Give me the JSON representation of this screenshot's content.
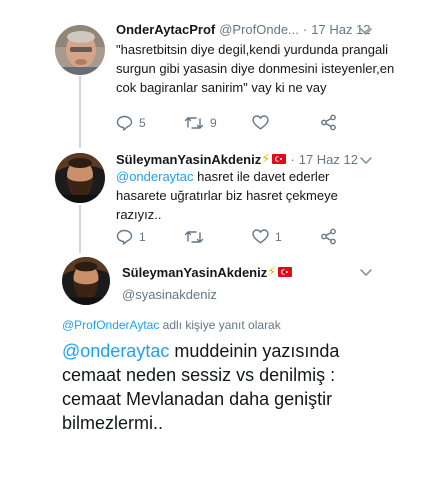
{
  "tweets": [
    {
      "name": "OnderAytacProf",
      "handle": "@ProfOnde...",
      "dot": "·",
      "time": "17 Haz 12",
      "text": "\"hasretbitsin diye degil,kendi yurdunda prangali surgun gibi yasasin diye donmesini isteyenler,en cok bagiranlar sanirim\" vay ki ne vay",
      "reply_count": "5",
      "retweet_count": "9",
      "like_count": ""
    },
    {
      "name": "SüleymanYasinAkdeniz",
      "name_suffix": "⚡",
      "dot": "·",
      "time": "17 Haz 12",
      "mention": "@onderaytac",
      "text": " hasret ile davet ederler hasarete uğratırlar biz hasret çekmeye razıyız..",
      "reply_count": "1",
      "retweet_count": "",
      "like_count": "1"
    }
  ],
  "main_tweet": {
    "name": "SüleymanYasinAkdeniz",
    "name_suffix": "⚡",
    "handle": "@syasinakdeniz",
    "reply_to_mention": "@ProfOnderAytac",
    "reply_to_rest": " adlı kişiye yanıt olarak",
    "mention": "@onderaytac",
    "text": " muddeinin yazısında cemaat neden sessiz vs denilmiş : cemaat Mevlanadan daha geniştir bilmezlermi.."
  },
  "icons": [
    "reply-icon",
    "retweet-icon",
    "like-icon",
    "share-icon",
    "chevron-down-icon",
    "turkey-flag-icon"
  ],
  "colors": {
    "accent": "#1da1f2",
    "muted": "#657786",
    "thread_line": "#ccd6dd",
    "text": "#14171a",
    "flag_red": "#e30a17"
  }
}
